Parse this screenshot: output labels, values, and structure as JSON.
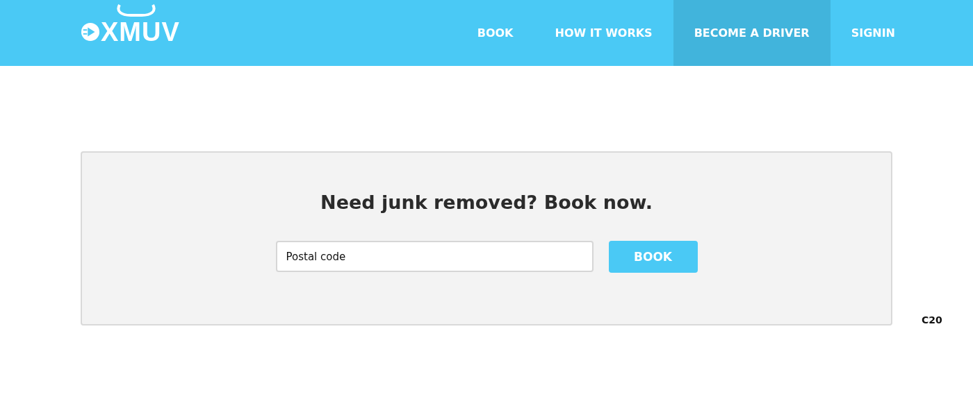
{
  "logo": {
    "text": "XMUV"
  },
  "nav": [
    {
      "label": "BOOK",
      "selected": false
    },
    {
      "label": "HOW IT WORKS",
      "selected": false
    },
    {
      "label": "BECOME A DRIVER",
      "selected": true
    },
    {
      "label": "SIGNIN",
      "selected": false
    }
  ],
  "booking": {
    "heading": "Need junk removed? Book now.",
    "field": {
      "placeholder": "Postal code"
    },
    "button": "BOOK"
  },
  "corner_label": "C20"
}
